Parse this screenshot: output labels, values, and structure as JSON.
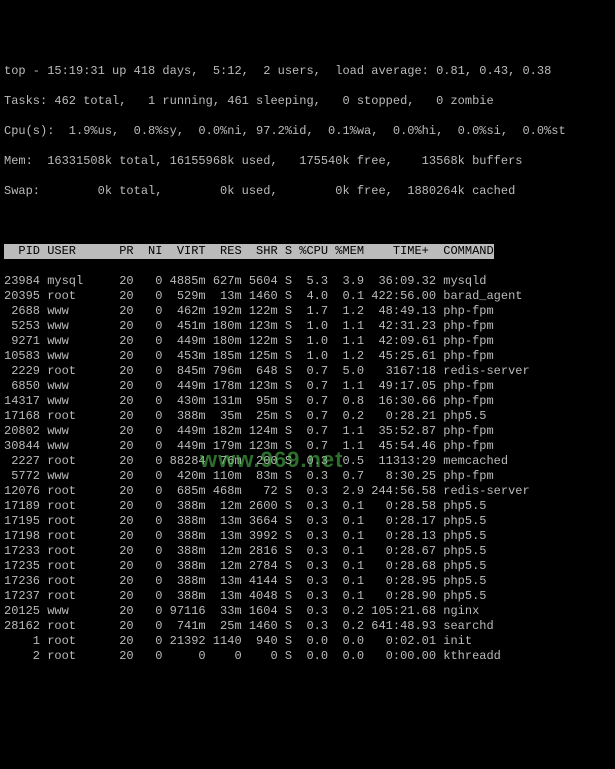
{
  "header": {
    "line1": "top - 15:19:31 up 418 days,  5:12,  2 users,  load average: 0.81, 0.43, 0.38",
    "line2": "Tasks: 462 total,   1 running, 461 sleeping,   0 stopped,   0 zombie",
    "line3": "Cpu(s):  1.9%us,  0.8%sy,  0.0%ni, 97.2%id,  0.1%wa,  0.0%hi,  0.0%si,  0.0%st",
    "line4": "Mem:  16331508k total, 16155968k used,   175540k free,    13568k buffers",
    "line5": "Swap:        0k total,        0k used,        0k free,  1880264k cached"
  },
  "columns": "  PID USER      PR  NI  VIRT  RES  SHR S %CPU %MEM    TIME+  COMMAND",
  "processes": [
    {
      "pid": "23984",
      "user": "mysql",
      "pr": "20",
      "ni": "0",
      "virt": "4885m",
      "res": "627m",
      "shr": "5604",
      "s": "S",
      "cpu": "5.3",
      "mem": "3.9",
      "time": "36:09.32",
      "cmd": "mysqld"
    },
    {
      "pid": "20395",
      "user": "root",
      "pr": "20",
      "ni": "0",
      "virt": "529m",
      "res": "13m",
      "shr": "1460",
      "s": "S",
      "cpu": "4.0",
      "mem": "0.1",
      "time": "422:56.00",
      "cmd": "barad_agent"
    },
    {
      "pid": "2688",
      "user": "www",
      "pr": "20",
      "ni": "0",
      "virt": "462m",
      "res": "192m",
      "shr": "122m",
      "s": "S",
      "cpu": "1.7",
      "mem": "1.2",
      "time": "48:49.13",
      "cmd": "php-fpm"
    },
    {
      "pid": "5253",
      "user": "www",
      "pr": "20",
      "ni": "0",
      "virt": "451m",
      "res": "180m",
      "shr": "123m",
      "s": "S",
      "cpu": "1.0",
      "mem": "1.1",
      "time": "42:31.23",
      "cmd": "php-fpm"
    },
    {
      "pid": "9271",
      "user": "www",
      "pr": "20",
      "ni": "0",
      "virt": "449m",
      "res": "180m",
      "shr": "122m",
      "s": "S",
      "cpu": "1.0",
      "mem": "1.1",
      "time": "42:09.61",
      "cmd": "php-fpm"
    },
    {
      "pid": "10583",
      "user": "www",
      "pr": "20",
      "ni": "0",
      "virt": "453m",
      "res": "185m",
      "shr": "125m",
      "s": "S",
      "cpu": "1.0",
      "mem": "1.2",
      "time": "45:25.61",
      "cmd": "php-fpm"
    },
    {
      "pid": "2229",
      "user": "root",
      "pr": "20",
      "ni": "0",
      "virt": "845m",
      "res": "796m",
      "shr": "648",
      "s": "S",
      "cpu": "0.7",
      "mem": "5.0",
      "time": "3167:18",
      "cmd": "redis-server"
    },
    {
      "pid": "6850",
      "user": "www",
      "pr": "20",
      "ni": "0",
      "virt": "449m",
      "res": "178m",
      "shr": "123m",
      "s": "S",
      "cpu": "0.7",
      "mem": "1.1",
      "time": "49:17.05",
      "cmd": "php-fpm"
    },
    {
      "pid": "14317",
      "user": "www",
      "pr": "20",
      "ni": "0",
      "virt": "430m",
      "res": "131m",
      "shr": "95m",
      "s": "S",
      "cpu": "0.7",
      "mem": "0.8",
      "time": "16:30.66",
      "cmd": "php-fpm"
    },
    {
      "pid": "17168",
      "user": "root",
      "pr": "20",
      "ni": "0",
      "virt": "388m",
      "res": "35m",
      "shr": "25m",
      "s": "S",
      "cpu": "0.7",
      "mem": "0.2",
      "time": "0:28.21",
      "cmd": "php5.5"
    },
    {
      "pid": "20802",
      "user": "www",
      "pr": "20",
      "ni": "0",
      "virt": "449m",
      "res": "182m",
      "shr": "124m",
      "s": "S",
      "cpu": "0.7",
      "mem": "1.1",
      "time": "35:52.87",
      "cmd": "php-fpm"
    },
    {
      "pid": "30844",
      "user": "www",
      "pr": "20",
      "ni": "0",
      "virt": "449m",
      "res": "179m",
      "shr": "123m",
      "s": "S",
      "cpu": "0.7",
      "mem": "1.1",
      "time": "45:54.46",
      "cmd": "php-fpm"
    },
    {
      "pid": "2227",
      "user": "root",
      "pr": "20",
      "ni": "0",
      "virt": "88284",
      "res": "76m",
      "shr": "200",
      "s": "S",
      "cpu": "0.3",
      "mem": "0.5",
      "time": "11313:29",
      "cmd": "memcached"
    },
    {
      "pid": "5772",
      "user": "www",
      "pr": "20",
      "ni": "0",
      "virt": "420m",
      "res": "110m",
      "shr": "83m",
      "s": "S",
      "cpu": "0.3",
      "mem": "0.7",
      "time": "8:30.25",
      "cmd": "php-fpm"
    },
    {
      "pid": "12076",
      "user": "root",
      "pr": "20",
      "ni": "0",
      "virt": "685m",
      "res": "468m",
      "shr": "72",
      "s": "S",
      "cpu": "0.3",
      "mem": "2.9",
      "time": "244:56.58",
      "cmd": "redis-server"
    },
    {
      "pid": "17189",
      "user": "root",
      "pr": "20",
      "ni": "0",
      "virt": "388m",
      "res": "12m",
      "shr": "2600",
      "s": "S",
      "cpu": "0.3",
      "mem": "0.1",
      "time": "0:28.58",
      "cmd": "php5.5"
    },
    {
      "pid": "17195",
      "user": "root",
      "pr": "20",
      "ni": "0",
      "virt": "388m",
      "res": "13m",
      "shr": "3664",
      "s": "S",
      "cpu": "0.3",
      "mem": "0.1",
      "time": "0:28.17",
      "cmd": "php5.5"
    },
    {
      "pid": "17198",
      "user": "root",
      "pr": "20",
      "ni": "0",
      "virt": "388m",
      "res": "13m",
      "shr": "3992",
      "s": "S",
      "cpu": "0.3",
      "mem": "0.1",
      "time": "0:28.13",
      "cmd": "php5.5"
    },
    {
      "pid": "17233",
      "user": "root",
      "pr": "20",
      "ni": "0",
      "virt": "388m",
      "res": "12m",
      "shr": "2816",
      "s": "S",
      "cpu": "0.3",
      "mem": "0.1",
      "time": "0:28.67",
      "cmd": "php5.5"
    },
    {
      "pid": "17235",
      "user": "root",
      "pr": "20",
      "ni": "0",
      "virt": "388m",
      "res": "12m",
      "shr": "2784",
      "s": "S",
      "cpu": "0.3",
      "mem": "0.1",
      "time": "0:28.68",
      "cmd": "php5.5"
    },
    {
      "pid": "17236",
      "user": "root",
      "pr": "20",
      "ni": "0",
      "virt": "388m",
      "res": "13m",
      "shr": "4144",
      "s": "S",
      "cpu": "0.3",
      "mem": "0.1",
      "time": "0:28.95",
      "cmd": "php5.5"
    },
    {
      "pid": "17237",
      "user": "root",
      "pr": "20",
      "ni": "0",
      "virt": "388m",
      "res": "13m",
      "shr": "4048",
      "s": "S",
      "cpu": "0.3",
      "mem": "0.1",
      "time": "0:28.90",
      "cmd": "php5.5"
    },
    {
      "pid": "20125",
      "user": "www",
      "pr": "20",
      "ni": "0",
      "virt": "97116",
      "res": "33m",
      "shr": "1604",
      "s": "S",
      "cpu": "0.3",
      "mem": "0.2",
      "time": "105:21.68",
      "cmd": "nginx"
    },
    {
      "pid": "28162",
      "user": "root",
      "pr": "20",
      "ni": "0",
      "virt": "741m",
      "res": "25m",
      "shr": "1460",
      "s": "S",
      "cpu": "0.3",
      "mem": "0.2",
      "time": "641:48.93",
      "cmd": "searchd"
    },
    {
      "pid": "1",
      "user": "root",
      "pr": "20",
      "ni": "0",
      "virt": "21392",
      "res": "1140",
      "shr": "940",
      "s": "S",
      "cpu": "0.0",
      "mem": "0.0",
      "time": "0:02.01",
      "cmd": "init"
    },
    {
      "pid": "2",
      "user": "root",
      "pr": "20",
      "ni": "0",
      "virt": "0",
      "res": "0",
      "shr": "0",
      "s": "S",
      "cpu": "0.0",
      "mem": "0.0",
      "time": "0:00.00",
      "cmd": "kthreadd"
    }
  ],
  "watermark": "www.969.net"
}
